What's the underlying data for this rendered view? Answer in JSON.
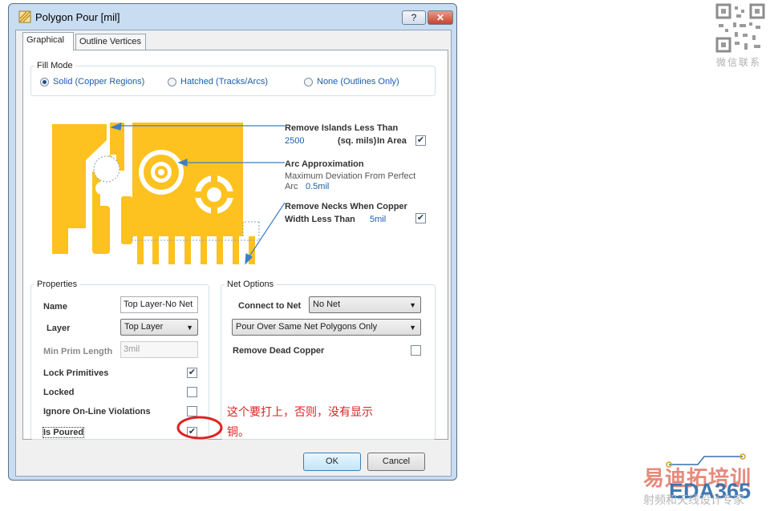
{
  "window": {
    "title": "Polygon Pour [mil]",
    "help_label": "?",
    "close_label": "✕"
  },
  "tabs": [
    {
      "label": "Graphical"
    },
    {
      "label": "Outline Vertices"
    }
  ],
  "fill_mode": {
    "label": "Fill Mode",
    "options": [
      {
        "label": "Solid (Copper Regions)",
        "selected": true
      },
      {
        "label": "Hatched (Tracks/Arcs)",
        "selected": false
      },
      {
        "label": "None (Outlines Only)",
        "selected": false
      }
    ]
  },
  "remove_islands": {
    "label": "Remove Islands Less Than",
    "value": "2500",
    "unit": "(sq. mils)",
    "in_area_label": "In Area",
    "checked": true
  },
  "arc_approximation": {
    "label": "Arc Approximation",
    "desc_line1": "Maximum Deviation From Perfect",
    "desc_line2": "Arc",
    "value": "0.5mil"
  },
  "remove_necks": {
    "label_line1": "Remove Necks When Copper",
    "label_line2": "Width Less Than",
    "value": "5mil",
    "checked": true
  },
  "properties": {
    "label": "Properties",
    "name_label": "Name",
    "name_value": "Top Layer-No Net",
    "layer_label": "Layer",
    "layer_value": "Top Layer",
    "min_prim_label": "Min Prim Length",
    "min_prim_value": "3mil",
    "lock_primitives_label": "Lock Primitives",
    "lock_primitives_checked": true,
    "locked_label": "Locked",
    "locked_checked": false,
    "ignore_violations_label": "Ignore On-Line Violations",
    "ignore_violations_checked": false,
    "is_poured_label": "Is Poured",
    "is_poured_checked": true
  },
  "net_options": {
    "label": "Net Options",
    "connect_label": "Connect to Net",
    "connect_value": "No Net",
    "pour_over_value": "Pour Over Same Net Polygons Only",
    "remove_dead_label": "Remove Dead Copper",
    "remove_dead_checked": false
  },
  "buttons": {
    "ok": "OK",
    "cancel": "Cancel"
  },
  "annotation": {
    "text": "这个要打上，否则，没有显示铜。",
    "color": "#e02020"
  },
  "watermark": {
    "qr_caption": "微信联系",
    "brand_cn": "易迪拓培训",
    "brand_en": "EDA365",
    "brand_sub": "射频和天线设计专家"
  },
  "colors": {
    "copper": "#fdc21f",
    "accent_text": "#1a5ea8",
    "annotation": "#e02020"
  }
}
